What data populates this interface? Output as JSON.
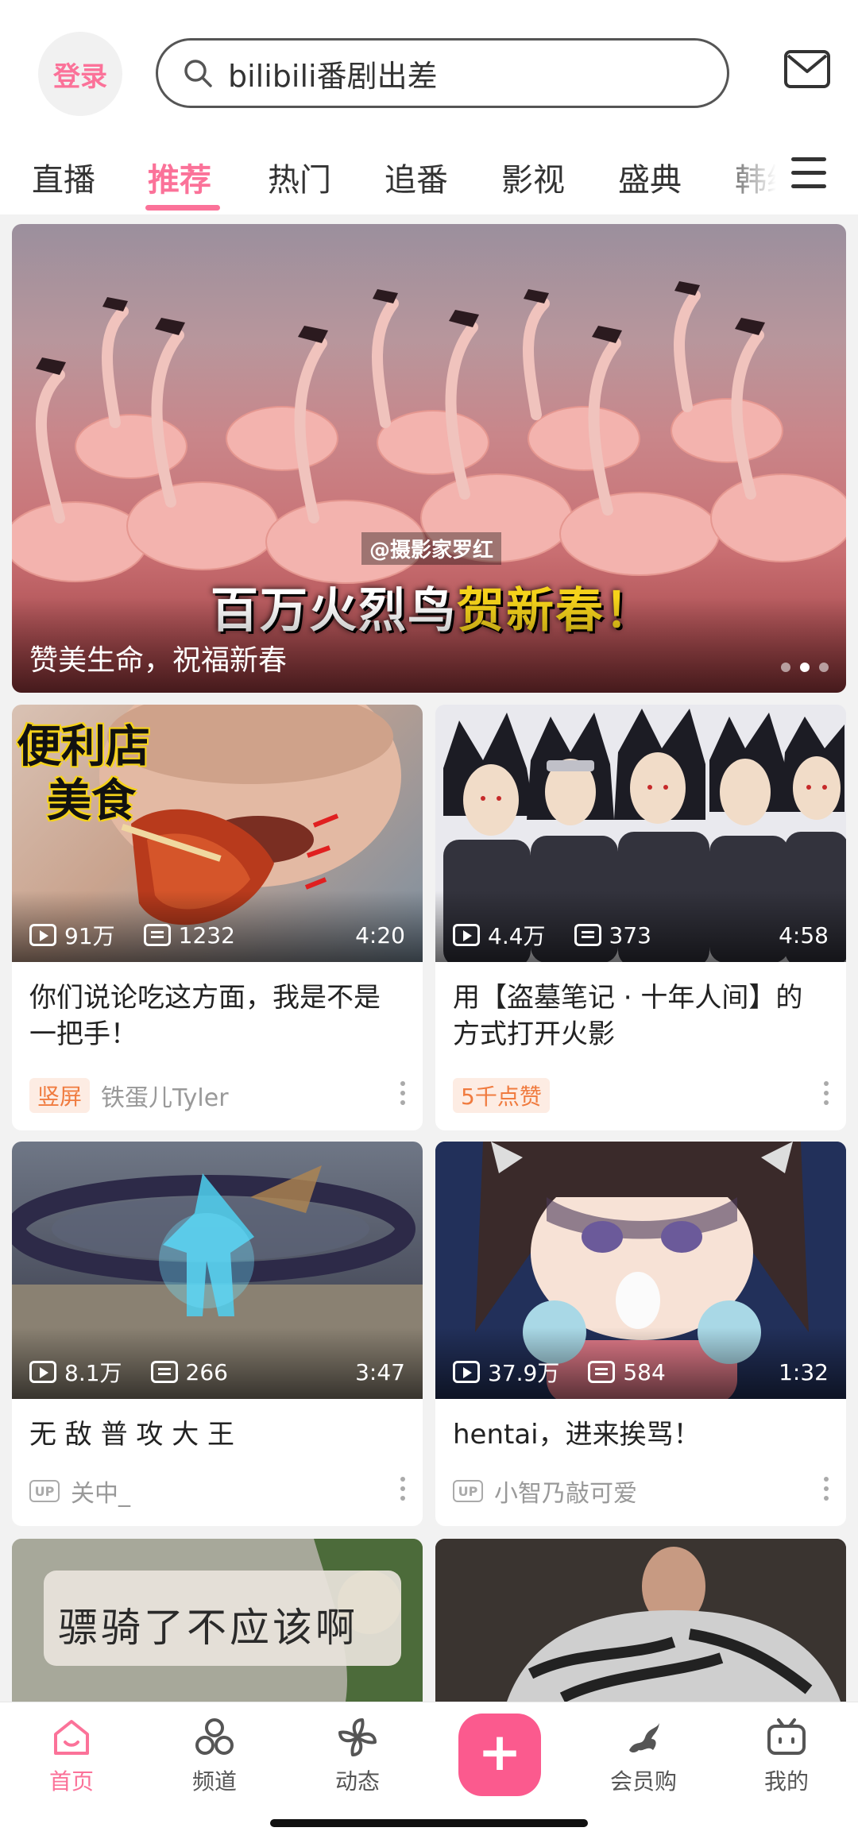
{
  "header": {
    "login_label": "登录",
    "search_text": "bilibili番剧出差"
  },
  "tabs": [
    "直播",
    "推荐",
    "热门",
    "追番",
    "影视",
    "盛典",
    "韩综"
  ],
  "active_tab": "推荐",
  "banner": {
    "credit": "@摄影家罗红",
    "headline_white": "百万火烈鸟",
    "headline_yellow": "贺新春！",
    "caption": "赞美生命，祝福新春",
    "active_dot": 2,
    "dot_count": 3
  },
  "cards": [
    {
      "overlay_text_line1": "便利店",
      "overlay_text_line2": "美食",
      "views": "91万",
      "danmaku": "1232",
      "duration": "4:20",
      "title": "你们说论吃这方面，我是不是一把手！",
      "tag": "竖屏",
      "author": "铁蛋儿Tyler"
    },
    {
      "views": "4.4万",
      "danmaku": "373",
      "duration": "4:58",
      "title": "用【盗墓笔记 · 十年人间】的方式打开火影",
      "tag": "5千点赞",
      "author": ""
    },
    {
      "views": "8.1万",
      "danmaku": "266",
      "duration": "3:47",
      "title": "无 敌 普 攻 大 王",
      "up_label": "UP",
      "author": "关中_"
    },
    {
      "views": "37.9万",
      "danmaku": "584",
      "duration": "1:32",
      "title": "hentai，进来挨骂！",
      "up_label": "UP",
      "author": "小智乃敲可爱"
    },
    {
      "overlay_text": "骠骑了不应该啊"
    },
    {}
  ],
  "nav": {
    "home": "首页",
    "channel": "频道",
    "dynamic": "动态",
    "add": "+",
    "shop": "会员购",
    "mine": "我的"
  },
  "colors": {
    "accent": "#fb7299",
    "tag_orange": "#f07b3f"
  }
}
